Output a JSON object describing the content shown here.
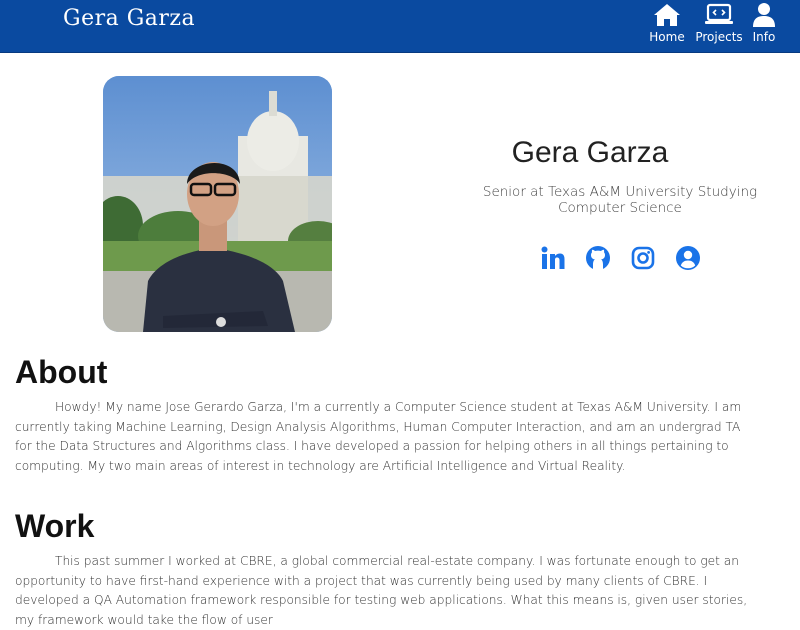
{
  "brand": "Gera Garza",
  "nav": {
    "home": {
      "label": "Home",
      "icon": "home-icon"
    },
    "projects": {
      "label": "Projects",
      "icon": "laptop-code-icon"
    },
    "info": {
      "label": "Info",
      "icon": "user-icon"
    }
  },
  "hero": {
    "name": "Gera Garza",
    "subtitle": "Senior at Texas A&M University Studying Computer Science",
    "socials": [
      "linkedin-icon",
      "github-icon",
      "instagram-icon",
      "user-circle-icon"
    ]
  },
  "about": {
    "title": "About",
    "text": "Howdy! My name Jose Gerardo Garza, I'm a currently a Computer Science student at Texas A&M University. I am currently taking Machine Learning, Design Analysis Algorithms, Human Computer Interaction, and am an undergrad TA for the Data Structures and Algorithms class. I have developed a passion for helping others in all things pertaining to computing. My two main areas of interest in technology are Artificial Intelligence and Virtual Reality."
  },
  "work": {
    "title": "Work",
    "text": "This past summer I worked at CBRE, a global commercial real-estate company. I was fortunate enough to get an opportunity to have first-hand experience with a project that was currently being used by many clients of CBRE. I developed a QA Automation framework responsible for testing web applications. What this means is, given user stories, my framework would take the flow of user"
  },
  "colors": {
    "navbar": "#0a4aa0",
    "accent": "#1a73e8"
  }
}
